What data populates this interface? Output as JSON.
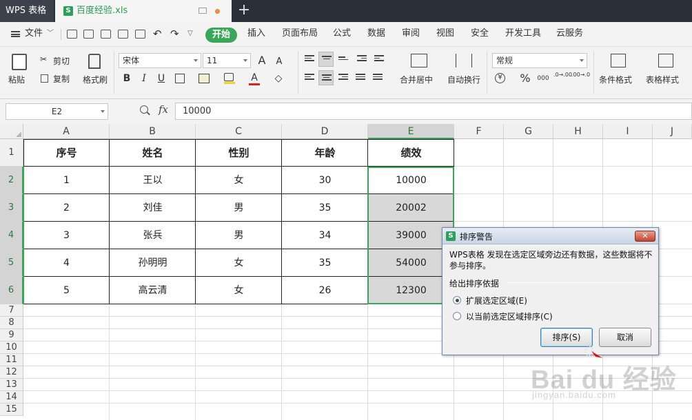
{
  "titlebar": {
    "app_name": "WPS 表格",
    "file_name": "百度经验.xls",
    "file_icon": "xls-s-icon",
    "new_tab_glyph": "+"
  },
  "menubar": {
    "file_label": "文件",
    "active_tab": "开始",
    "tabs": [
      "插入",
      "页面布局",
      "公式",
      "数据",
      "审阅",
      "视图",
      "安全",
      "开发工具",
      "云服务"
    ]
  },
  "ribbon": {
    "paste": "粘贴",
    "cut": "剪切",
    "copy": "复制",
    "format_painter": "格式刷",
    "font_name": "宋体",
    "font_size": "11",
    "merge_center": "合并居中",
    "wrap_text": "自动换行",
    "number_format": "常规",
    "cond_format": "条件格式",
    "table_style": "表格样式",
    "bold": "B",
    "italic": "I",
    "underline": "U",
    "percent": "%",
    "thousands": "000",
    "inc_dec": ".0→.00",
    "dec_dec": ".00→.0",
    "font_grow": "A",
    "font_shrink": "A",
    "font_color_glyph": "A"
  },
  "formula_bar": {
    "name_box": "E2",
    "fx_label": "fx",
    "value": "10000"
  },
  "sheet": {
    "columns": [
      "A",
      "B",
      "C",
      "D",
      "E",
      "F",
      "G",
      "H",
      "I",
      "J"
    ],
    "rows": [
      "1",
      "2",
      "3",
      "4",
      "5",
      "6",
      "7",
      "8",
      "9",
      "10",
      "11",
      "12",
      "13",
      "14",
      "15"
    ],
    "headers": [
      "序号",
      "姓名",
      "性别",
      "年龄",
      "绩效"
    ],
    "data": [
      [
        "1",
        "王以",
        "女",
        "30",
        "10000"
      ],
      [
        "2",
        "刘佳",
        "男",
        "35",
        "20002"
      ],
      [
        "3",
        "张兵",
        "男",
        "34",
        "39000"
      ],
      [
        "4",
        "孙明明",
        "女",
        "35",
        "54000"
      ],
      [
        "5",
        "高云清",
        "女",
        "26",
        "12300"
      ]
    ],
    "selected_column": "E",
    "selected_rows": [
      "2",
      "3",
      "4",
      "5",
      "6"
    ]
  },
  "dialog": {
    "title": "排序警告",
    "close_glyph": "✕",
    "message": "WPS表格 发现在选定区域旁边还有数据，这些数据将不参与排序。",
    "group_label": "给出排序依据",
    "option_expand": "扩展选定区域(E)",
    "option_current": "以当前选定区域排序(C)",
    "selected_option": "expand",
    "sort_button": "排序(S)",
    "cancel_button": "取消"
  },
  "watermark": {
    "brand": "Bai du 经验",
    "url": "jingyan.baidu.com"
  },
  "colors": {
    "accent_green": "#3aa65a",
    "titlebar_bg": "#2b2f37",
    "selection_fill": "#d8d8d8"
  }
}
